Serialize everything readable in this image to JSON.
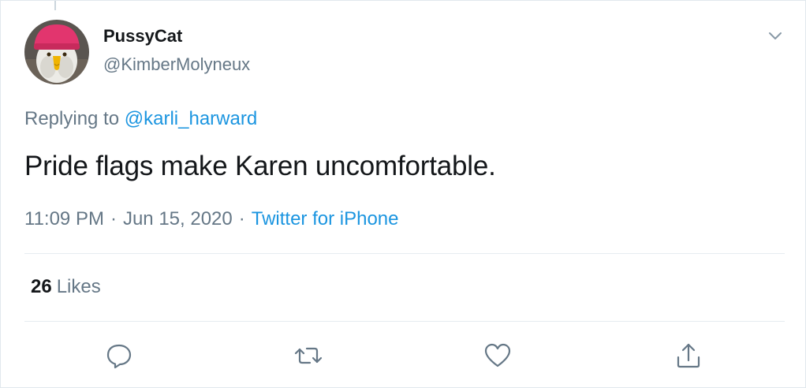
{
  "tweet": {
    "display_name": "PussyCat",
    "handle": "@KimberMolyneux",
    "replying_to_label": "Replying to",
    "replying_to_handle": "@karli_harward",
    "text": "Pride flags make Karen uncomfortable.",
    "time": "11:09 PM",
    "date": "Jun 15, 2020",
    "source": "Twitter for iPhone",
    "separator": "·"
  },
  "stats": {
    "likes_count": "26",
    "likes_label": "Likes"
  },
  "icons": {
    "more": "chevron-down-icon",
    "reply": "reply-icon",
    "retweet": "retweet-icon",
    "like": "heart-icon",
    "share": "share-icon"
  },
  "colors": {
    "link": "#1b95e0",
    "secondary_text": "#657786",
    "primary_text": "#14171a",
    "divider": "#e6ecf0"
  }
}
